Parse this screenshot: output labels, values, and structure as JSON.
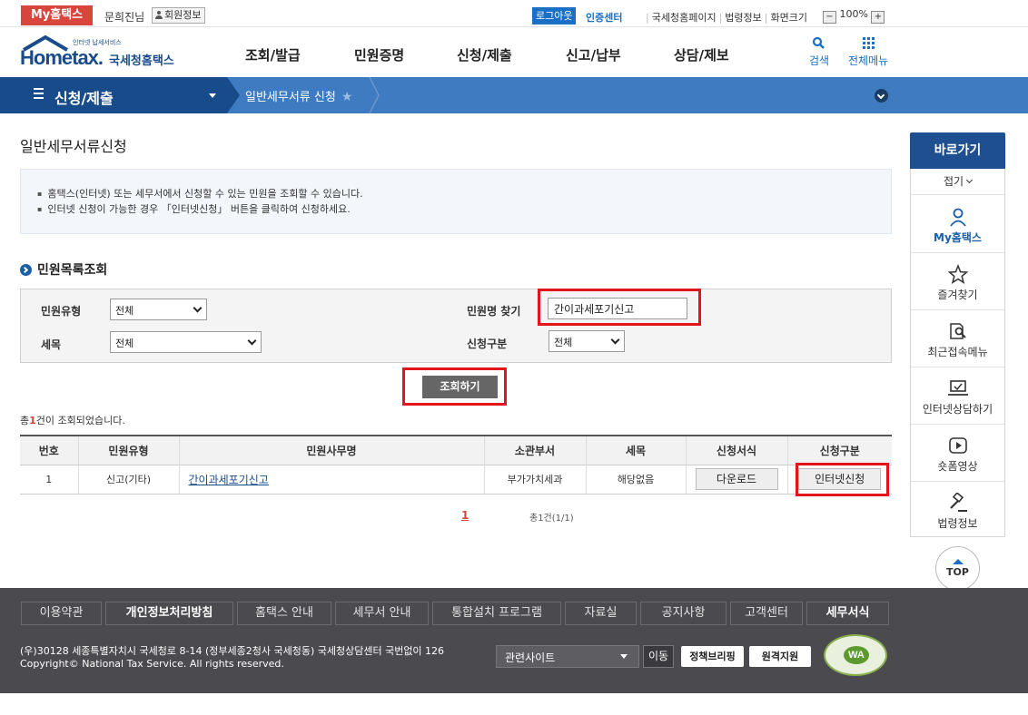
{
  "topbar": {
    "my_hometax": "My홈택스",
    "user_name": "문희진님",
    "member_info": "회원정보",
    "logout": "로그아웃",
    "cert_center": "인증센터",
    "links": [
      "국세청홈페이지",
      "법령정보",
      "화면크기"
    ],
    "zoom": "100%"
  },
  "header": {
    "logo_small": "인터넷 납세서비스",
    "logo_main": "Hometax.",
    "logo_kr": "국세청홈택스",
    "menu": [
      "조회/발급",
      "민원증명",
      "신청/제출",
      "신고/납부",
      "상담/제보"
    ],
    "search": "검색",
    "all_menu": "전체메뉴"
  },
  "navbar": {
    "section": "신청/제출",
    "crumb": "일반세무서류 신청"
  },
  "page": {
    "title": "일반세무서류신청",
    "info": [
      "홈택스(인터넷) 또는 세무서에서 신청할 수 있는 민원을 조회할 수 있습니다.",
      "인터넷 신청이 가능한 경우 「인터넷신청」 버튼을 클릭하여 신청하세요."
    ],
    "section_title": "민원목록조회"
  },
  "search": {
    "type_label": "민원유형",
    "type_value": "전체",
    "tax_label": "세목",
    "tax_value": "전체",
    "name_label": "민원명 찾기",
    "name_value": "간이과세포기신고",
    "apply_label": "신청구분",
    "apply_value": "전체",
    "query_button": "조회하기"
  },
  "result": {
    "prefix": "총",
    "count": "1",
    "suffix": "건이 조회되었습니다."
  },
  "table": {
    "headers": [
      "번호",
      "민원유형",
      "민원사무명",
      "소관부서",
      "세목",
      "신청서식",
      "신청구분"
    ],
    "rows": [
      {
        "no": "1",
        "type": "신고(기타)",
        "name": "간이과세포기신고",
        "dept": "부가가치세과",
        "tax": "해당없음",
        "form_button": "다운로드",
        "apply_button": "인터넷신청"
      }
    ]
  },
  "pager": {
    "current": "1",
    "total": "총1건(1/1)"
  },
  "quick": {
    "title": "바로가기",
    "fold": "접기",
    "items": [
      "My홈택스",
      "즐겨찾기",
      "최근접속메뉴",
      "인터넷상담하기",
      "숏폼영상",
      "법령정보"
    ],
    "top": "TOP"
  },
  "footer": {
    "nav": [
      "이용약관",
      "개인정보처리방침",
      "홈택스 안내",
      "세무서 안내",
      "통합설치 프로그램",
      "자료실",
      "공지사항",
      "고객센터",
      "세무서식"
    ],
    "address": "(우)30128 세종특별자치시 국세청로 8-14 (정부세종2청사 국세청동) 국세청상담센터 국번없이 126",
    "copyright": "Copyright© National Tax Service. All rights reserved.",
    "related_sites": "관련사이트",
    "go": "이동",
    "policy_briefing": "정책브리핑",
    "remote_support": "원격지원",
    "wa": "WA"
  },
  "colors": {
    "primary": "#1b6fc4",
    "navy": "#174b8a",
    "highlight": "#e3141b",
    "badge": "#d8453d"
  }
}
